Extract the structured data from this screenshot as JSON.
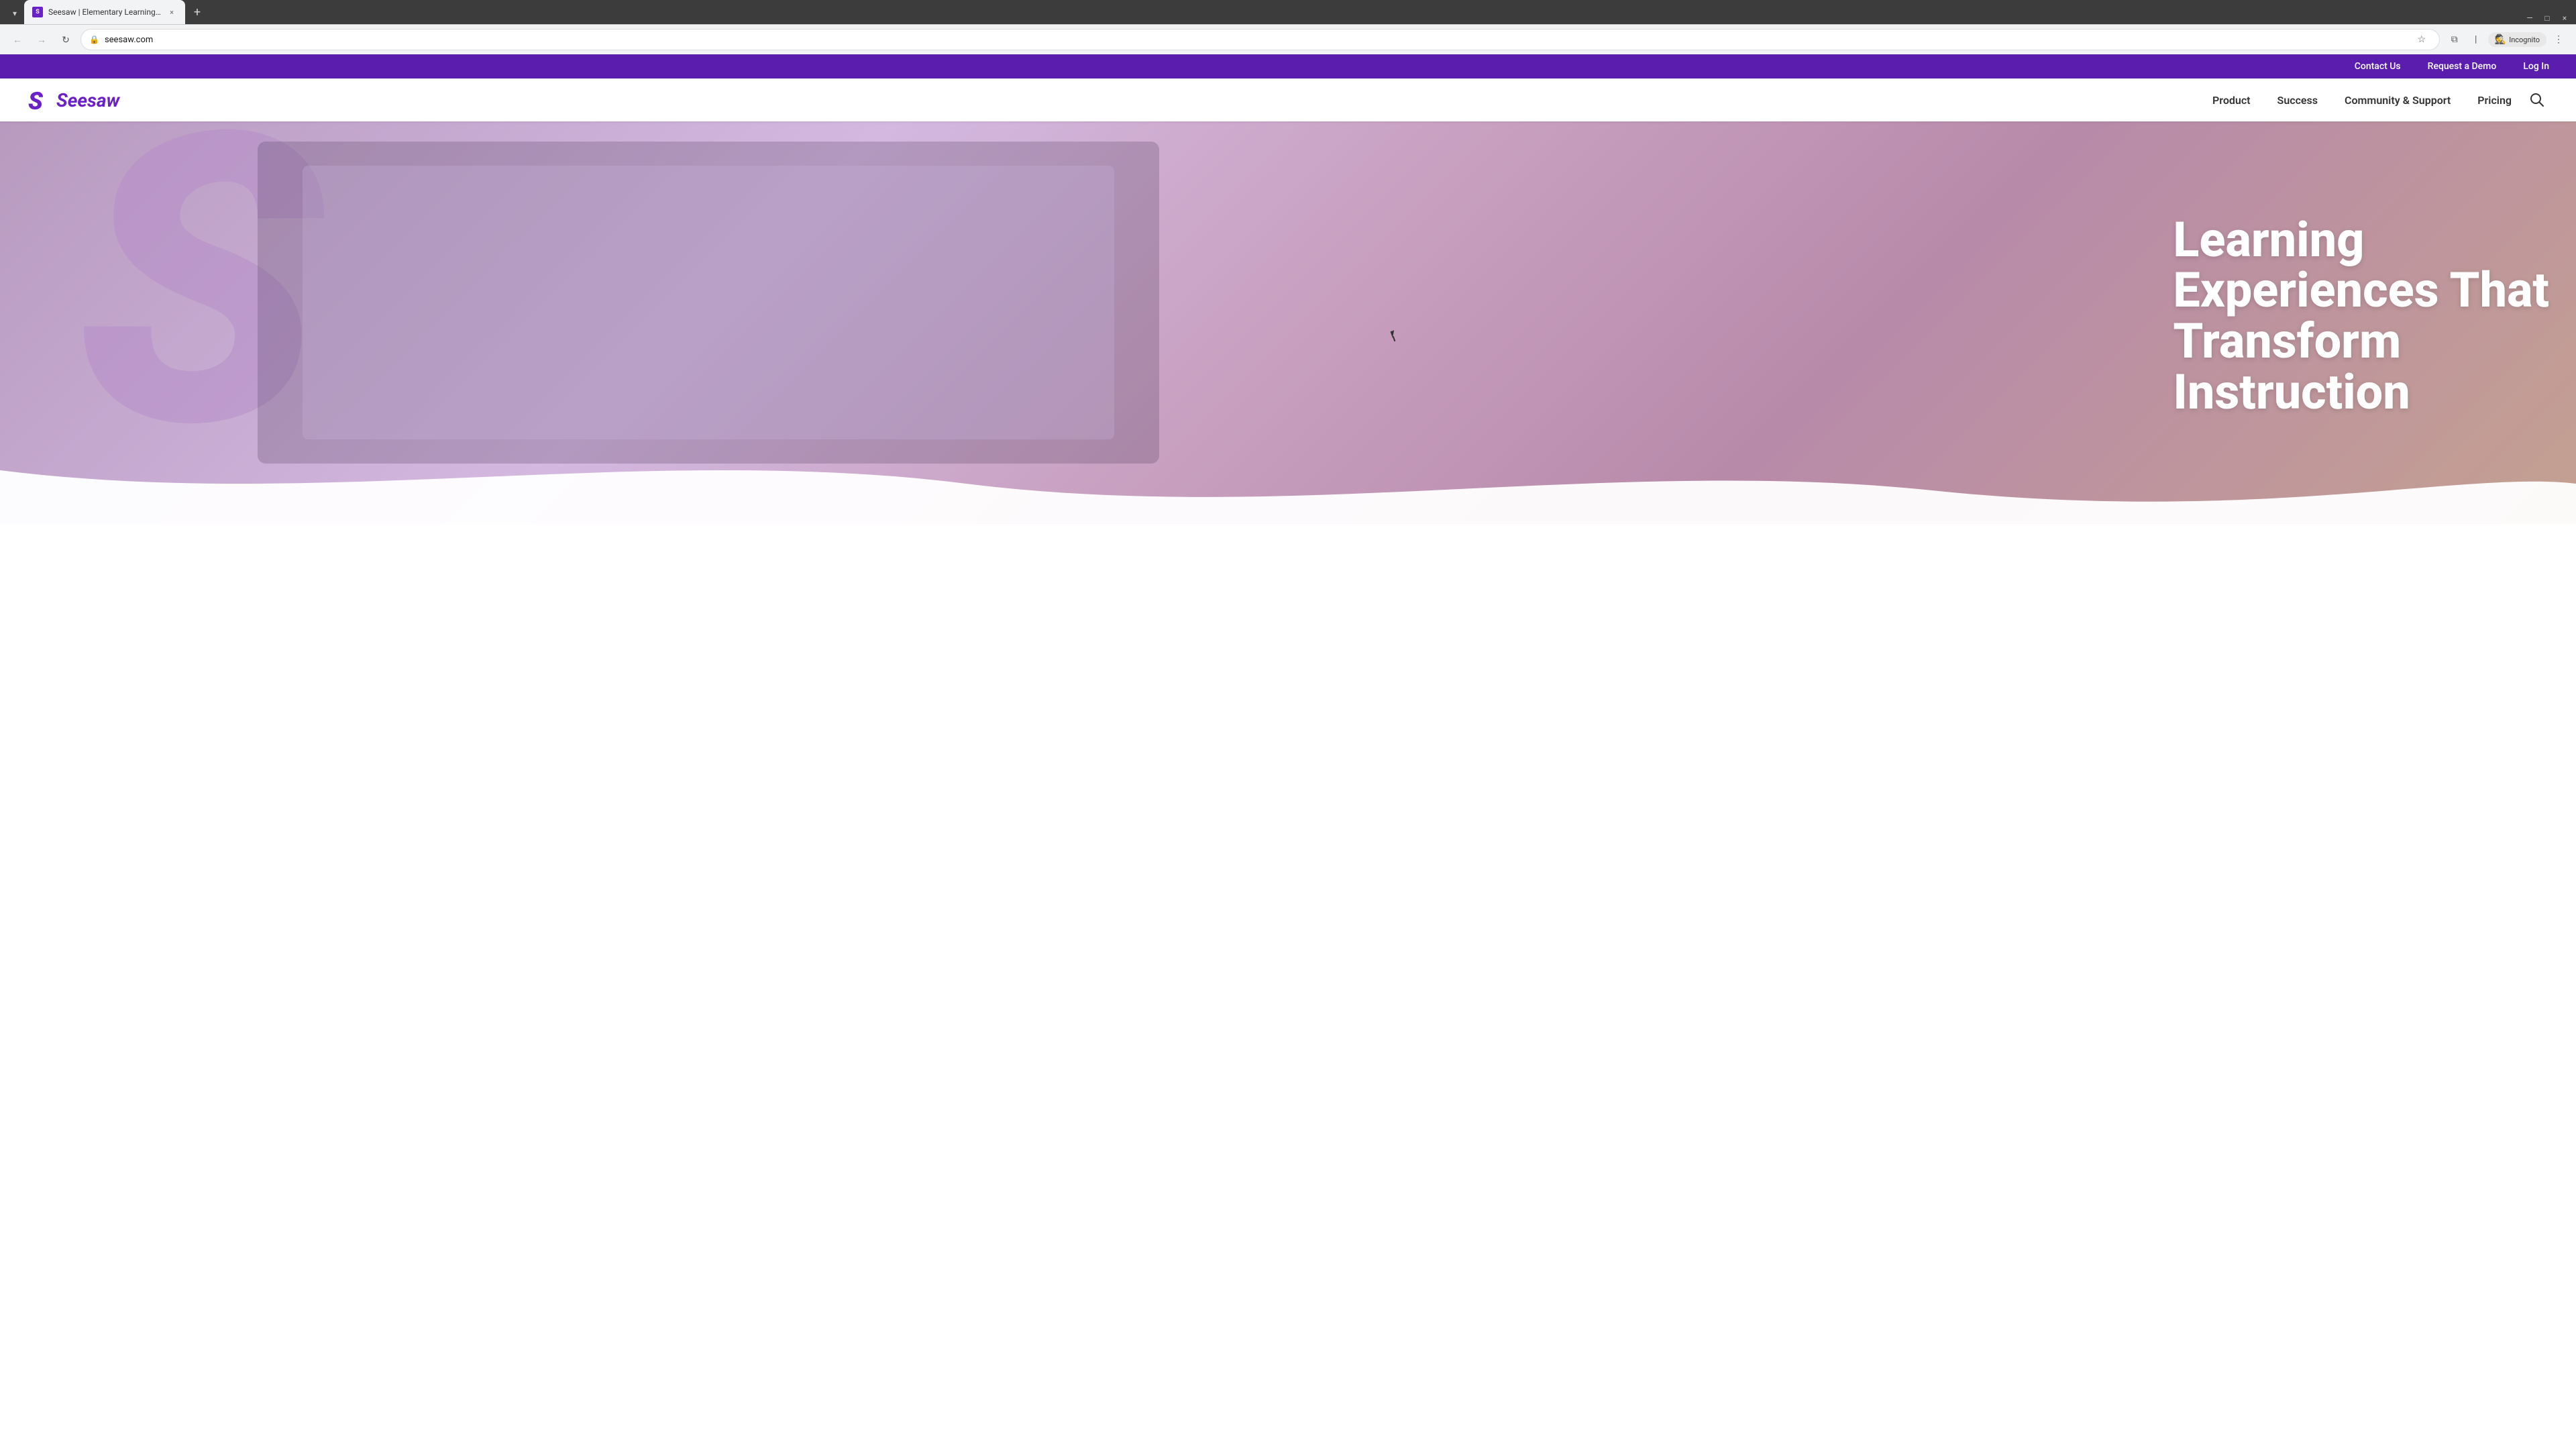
{
  "browser": {
    "tab_dropdown_icon": "▾",
    "tab_favicon_text": "S",
    "tab_title": "Seesaw | Elementary Learning E...",
    "tab_close_icon": "×",
    "tab_new_icon": "+",
    "nav_back_icon": "←",
    "nav_forward_icon": "→",
    "nav_refresh_icon": "↻",
    "address_icon": "🔒",
    "address_url": "seesaw.com",
    "bookmark_icon": "☆",
    "extensions_icon": "⧉",
    "profile_icon": "👤",
    "incognito_label": "Incognito",
    "more_icon": "⋮",
    "window_minimize": "—",
    "window_maximize": "□",
    "window_close": "×"
  },
  "utility_bar": {
    "contact_us": "Contact Us",
    "request_demo": "Request a Demo",
    "log_in": "Log In"
  },
  "nav": {
    "logo_text": "Seesaw",
    "product": "Product",
    "success": "Success",
    "community_support": "Community & Support",
    "pricing": "Pricing"
  },
  "hero": {
    "headline_line1": "Learning",
    "headline_line2": "Experiences That",
    "headline_line3": "Transform",
    "headline_line4": "Instruction",
    "s_watermark": "S"
  }
}
